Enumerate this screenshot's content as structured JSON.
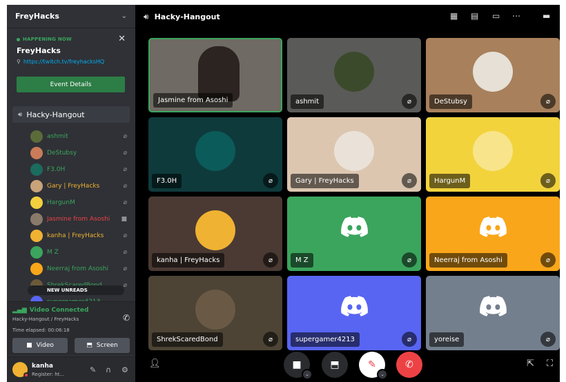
{
  "server": {
    "name": "FreyHacks"
  },
  "event": {
    "happening": "HAPPENING NOW",
    "title": "FreyHacks",
    "link": "https://twitch.tv/freyhacksHQ",
    "button": "Event Details"
  },
  "voice_channel": {
    "name": "Hacky-Hangout"
  },
  "members": [
    {
      "name": "ashmit",
      "color": "#3ba55d",
      "state": "mic-off-icon",
      "avatar": "#5c6b3a"
    },
    {
      "name": "DeStubsy",
      "color": "#3ba55d",
      "state": "mic-off-icon",
      "avatar": "#c97b5a"
    },
    {
      "name": "F3.0H",
      "color": "#3ba55d",
      "state": "mic-off-icon",
      "avatar": "#1b6b5e"
    },
    {
      "name": "Gary | FreyHacks",
      "color": "#f0b232",
      "state": "mic-off-icon",
      "avatar": "#c9a37a"
    },
    {
      "name": "HargunM",
      "color": "#3ba55d",
      "state": "mic-off-icon",
      "avatar": "#f4d03f"
    },
    {
      "name": "Jasmine from Asoshi",
      "color": "#ed4245",
      "state": "video-icon",
      "avatar": "#8a7a6a"
    },
    {
      "name": "kanha | FreyHacks",
      "color": "#f0b232",
      "state": "mic-off-icon",
      "avatar": "#f0b232"
    },
    {
      "name": "M Z",
      "color": "#3ba55d",
      "state": "mic-off-icon",
      "avatar": "#3ba55d"
    },
    {
      "name": "Neerraj from Asoshi",
      "color": "#3ba55d",
      "state": "mic-off-icon",
      "avatar": "#faa61a"
    },
    {
      "name": "ShrekScaredBond",
      "color": "#3ba55d",
      "state": "mic-off-icon",
      "avatar": "#6b5a3a"
    },
    {
      "name": "supergamer4213",
      "color": "#3ba55d",
      "state": "",
      "avatar": "#5865f2"
    }
  ],
  "new_unreads": "NEW UNREADS",
  "voice_panel": {
    "status": "Video Connected",
    "channel": "Hacky-Hangout / FreyHacks",
    "elapsed": "Time elapsed: 00:06:18",
    "video_label": "Video",
    "screen_label": "Screen"
  },
  "user": {
    "name": "kanha",
    "status": "Register: ht..."
  },
  "tiles": [
    {
      "name": "Jasmine from Asoshi",
      "bg": "#6f6a63",
      "kind": "camera",
      "mute": false
    },
    {
      "name": "ashmit",
      "bg": "#5a5a58",
      "kind": "avatar",
      "avatar": "#3c4a2c",
      "mute": true
    },
    {
      "name": "DeStubsy",
      "bg": "#a8805c",
      "kind": "avatar",
      "avatar": "#e6e0d6",
      "mute": true
    },
    {
      "name": "F3.0H",
      "bg": "#0f3a3c",
      "kind": "avatar",
      "avatar": "#0b5b5a",
      "mute": true
    },
    {
      "name": "Gary | FreyHacks",
      "bg": "#dcc6b0",
      "kind": "avatar",
      "avatar": "#eae2d8",
      "mute": true
    },
    {
      "name": "HargunM",
      "bg": "#f2d33c",
      "kind": "avatar",
      "avatar": "#f8e48a",
      "mute": true
    },
    {
      "name": "kanha | FreyHacks",
      "bg": "#4a3a33",
      "kind": "avatar",
      "avatar": "#f0b232",
      "mute": true
    },
    {
      "name": "M Z",
      "bg": "#3ba55d",
      "kind": "logo",
      "mute": true
    },
    {
      "name": "Neerraj from Asoshi",
      "bg": "#faa61a",
      "kind": "logo",
      "mute": true
    },
    {
      "name": "ShrekScaredBond",
      "bg": "#4d4435",
      "kind": "avatar",
      "avatar": "#6a5a45",
      "mute": true
    },
    {
      "name": "supergamer4213",
      "bg": "#5865f2",
      "kind": "logo",
      "mute": true
    },
    {
      "name": "yoreise",
      "bg": "#747f8d",
      "kind": "logo",
      "mute": true
    }
  ]
}
